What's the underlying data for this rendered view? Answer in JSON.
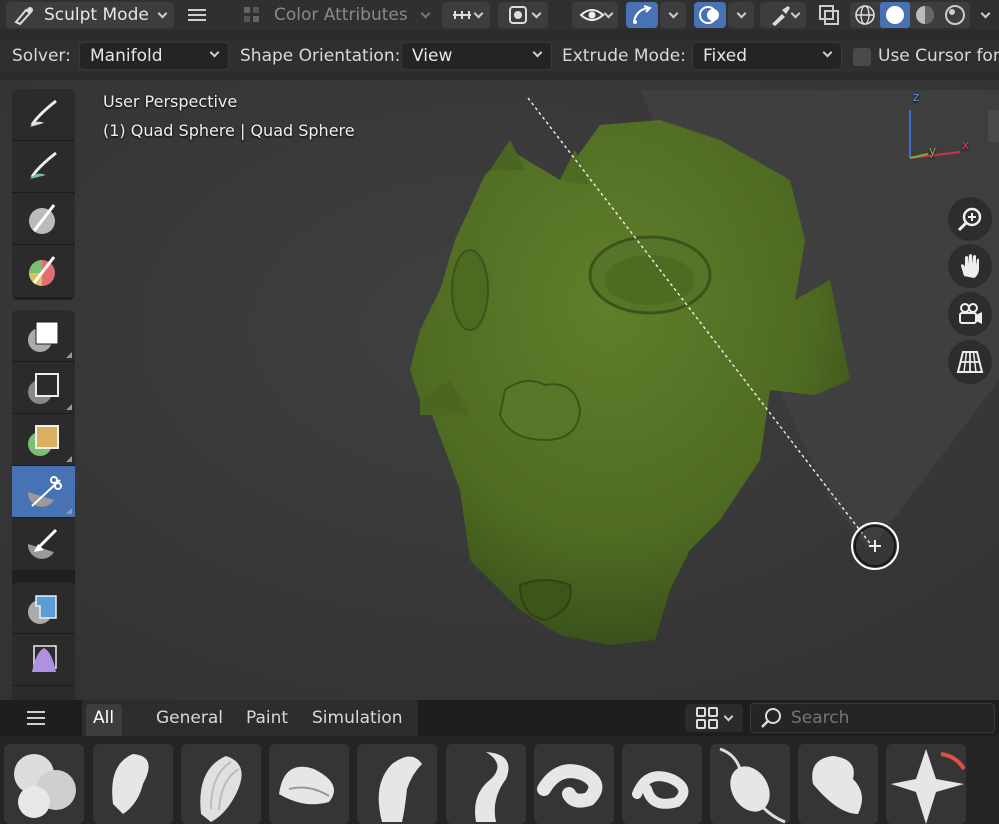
{
  "header": {
    "mode_label": "Sculpt Mode",
    "color_attributes_label": "Color Attributes"
  },
  "tool_settings": {
    "solver_label": "Solver:",
    "solver_value": "Manifold",
    "shape_orientation_label": "Shape Orientation:",
    "shape_orientation_value": "View",
    "extrude_mode_label": "Extrude Mode:",
    "extrude_mode_value": "Fixed",
    "use_cursor_label": "Use Cursor for"
  },
  "viewport": {
    "view_name": "User Perspective",
    "object_info": "(1) Quad Sphere | Quad Sphere",
    "axis_labels": {
      "z": "z",
      "y": "y",
      "x": "x"
    },
    "mesh_color": "#4e6b22",
    "accent_color": "#4772b3"
  },
  "asset_shelf": {
    "tabs": [
      {
        "label": "All",
        "active": true
      },
      {
        "label": "General",
        "active": false
      },
      {
        "label": "Paint",
        "active": false
      },
      {
        "label": "Simulation",
        "active": false
      }
    ],
    "search_placeholder": "Search",
    "brushes": [
      "blob",
      "clay",
      "clay-strips",
      "crease",
      "draw",
      "draw-sharp",
      "snake-hook",
      "snake-hook-2",
      "elastic",
      "flatten",
      "pinch"
    ]
  }
}
